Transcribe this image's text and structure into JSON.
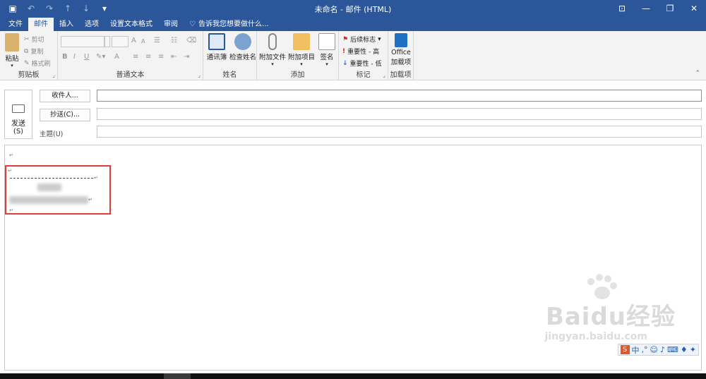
{
  "window": {
    "title": "未命名 - 邮件 (HTML)",
    "controls": [
      "restore-ribbon",
      "minimize",
      "maximize",
      "close"
    ]
  },
  "qat": {
    "icons": [
      "save-icon",
      "undo-icon",
      "redo-icon",
      "up-icon",
      "down-icon",
      "more-icon"
    ]
  },
  "tabs": [
    {
      "label": "文件"
    },
    {
      "label": "邮件",
      "active": true
    },
    {
      "label": "插入"
    },
    {
      "label": "选项"
    },
    {
      "label": "设置文本格式"
    },
    {
      "label": "审阅"
    }
  ],
  "tell_me": "告诉我您想要做什么...",
  "ribbon": {
    "clipboard": {
      "label": "剪贴板",
      "paste": "粘贴",
      "cut": "剪切",
      "copy": "复制",
      "format_painter": "格式刷"
    },
    "basic_text": {
      "label": "普通文本",
      "bold": "B",
      "italic": "I",
      "underline": "U",
      "grow": "A",
      "shrink": "A",
      "font_color": "A"
    },
    "names": {
      "label": "姓名",
      "address_book": "通讯簿",
      "check_names": "检查姓名"
    },
    "include": {
      "label": "添加",
      "attach_file": "附加文件",
      "attach_item": "附加项目",
      "signature": "签名"
    },
    "tags": {
      "label": "标记",
      "follow_up": "后续标志",
      "high": "重要性 - 高",
      "low": "重要性 - 低"
    },
    "addins": {
      "label": "加载项",
      "office_line1": "Office",
      "office_line2": "加载项"
    }
  },
  "compose": {
    "send_line1": "发送",
    "send_line2": "(S)",
    "to_button": "收件人...",
    "cc_button": "抄送(C)...",
    "subject_label": "主题(U)",
    "to_value": "",
    "cc_value": "",
    "subject_value": ""
  },
  "body": {
    "signature_visible_char": "↵"
  },
  "watermark": {
    "brand": "Baidu经验",
    "url": "jingyan.baidu.com"
  },
  "ime": {
    "logo": "S",
    "mode": "中"
  },
  "colors": {
    "accent": "#2b579a",
    "highlight_box": "#e23b3b"
  }
}
